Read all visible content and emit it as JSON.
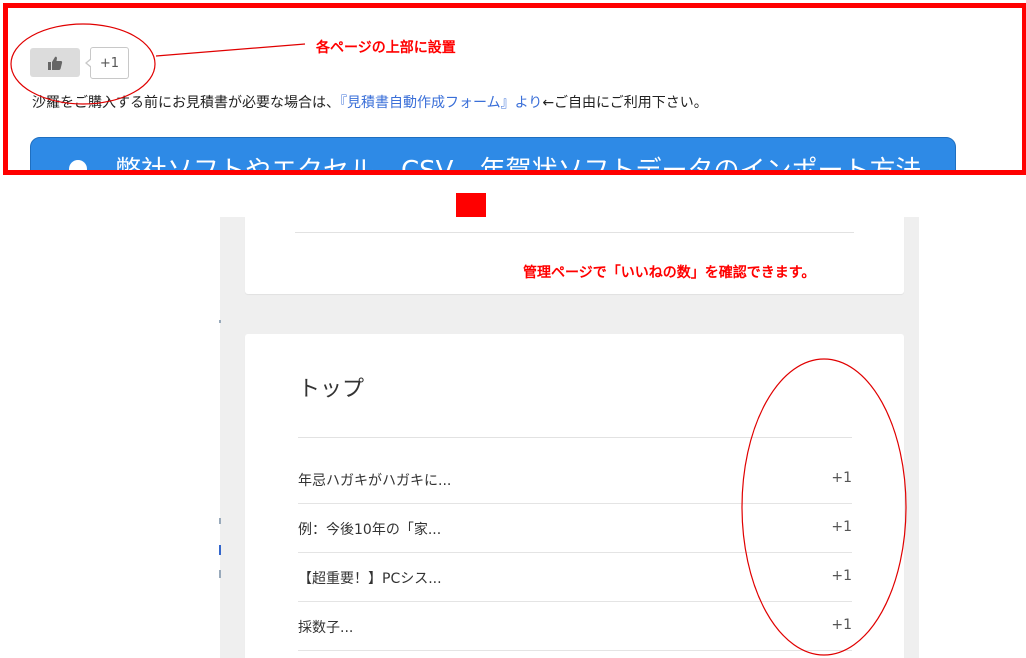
{
  "top_snippet": {
    "like_count": "+1",
    "annotation": "各ページの上部に設置",
    "intro_text_before": "沙羅をご購入する前にお見積書が必要な場合は、",
    "intro_link": "『見積書自動作成フォーム』より",
    "intro_text_after": "←ご自由にご利用下さい。",
    "banner_text": "弊社ソフトやエクセル、CSV、年賀状ソフトデータのインポート方法"
  },
  "middle": {
    "annotation": "管理ページで「いいねの数」を確認できます。"
  },
  "admin_panel": {
    "title": "トップ",
    "rows": [
      {
        "name": "年忌ハガキがハガキに...",
        "count": "+1"
      },
      {
        "name": "例：今後10年の「家...",
        "count": "+1"
      },
      {
        "name": "【超重要！】PCシス...",
        "count": "+1"
      },
      {
        "name": "採数子...",
        "count": "+1"
      }
    ]
  },
  "colors": {
    "annotation_red": "#ff0000",
    "banner_blue": "#2e8ae6",
    "link_blue": "#3a6fd8"
  },
  "icons": {
    "like": "thumbs-up-icon",
    "arrow": "arrow-down-icon"
  }
}
